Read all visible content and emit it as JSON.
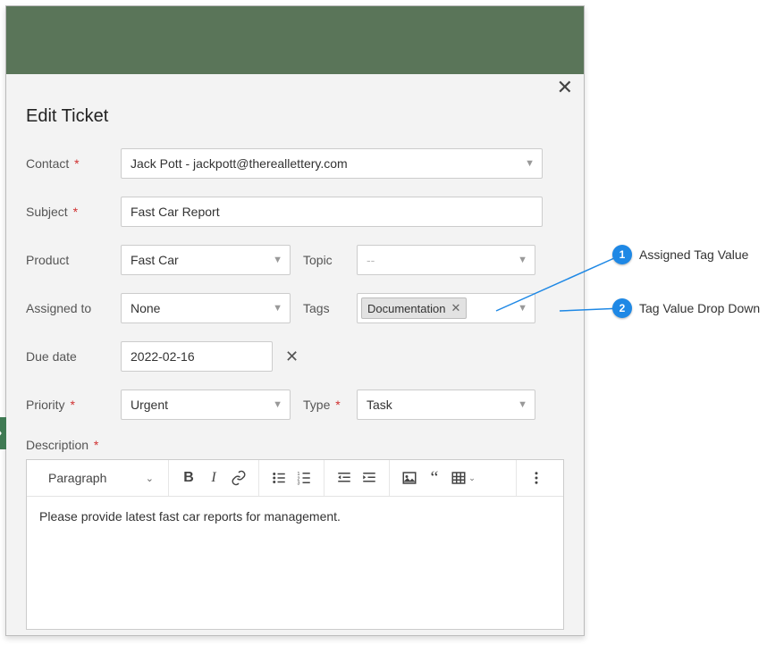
{
  "header": {
    "title": "Edit Ticket"
  },
  "form": {
    "contact": {
      "label": "Contact",
      "value": "Jack Pott - jackpott@thereallettery.com"
    },
    "subject": {
      "label": "Subject",
      "value": "Fast Car Report"
    },
    "product": {
      "label": "Product",
      "value": "Fast Car"
    },
    "topic": {
      "label": "Topic",
      "value": "--"
    },
    "assigned": {
      "label": "Assigned to",
      "value": "None"
    },
    "tags": {
      "label": "Tags",
      "chip": "Documentation"
    },
    "due": {
      "label": "Due date",
      "value": "2022-02-16"
    },
    "priority": {
      "label": "Priority",
      "value": "Urgent"
    },
    "type": {
      "label": "Type",
      "value": "Task"
    },
    "description_label": "Description"
  },
  "editor": {
    "format_select": "Paragraph",
    "body": "Please provide latest fast car reports for management."
  },
  "annotations": {
    "a1": {
      "num": "1",
      "text": "Assigned Tag Value"
    },
    "a2": {
      "num": "2",
      "text": "Tag Value Drop Down"
    }
  }
}
